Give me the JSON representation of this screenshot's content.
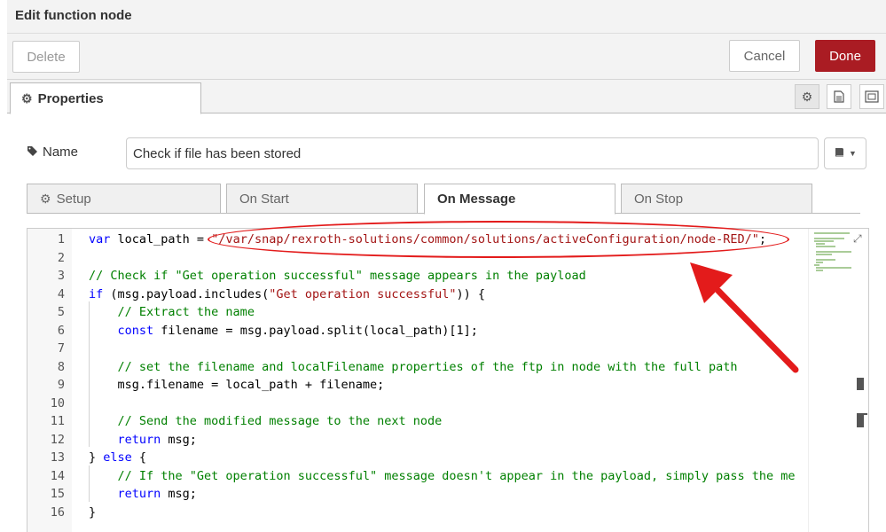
{
  "dialog": {
    "title": "Edit function node"
  },
  "toolbar": {
    "delete_label": "Delete",
    "cancel_label": "Cancel",
    "done_label": "Done",
    "done_color": "#aa1c23"
  },
  "tabs": {
    "properties_label": "Properties",
    "properties_icon": "gear-icon"
  },
  "side_icons": [
    "gear-icon",
    "document-icon",
    "layout-icon"
  ],
  "name_field": {
    "label": "Name",
    "label_icon": "tag-icon",
    "value": "Check if file has been stored",
    "button_icon": "book-icon"
  },
  "subtabs": [
    {
      "label": "Setup",
      "icon": "gear-icon",
      "active": false
    },
    {
      "label": "On Start",
      "active": false
    },
    {
      "label": "On Message",
      "active": true
    },
    {
      "label": "On Stop",
      "active": false
    }
  ],
  "code": {
    "line_numbers": [
      "1",
      "2",
      "3",
      "4",
      "5",
      "6",
      "7",
      "8",
      "9",
      "10",
      "11",
      "12",
      "13",
      "14",
      "15",
      "16"
    ],
    "lines": [
      [
        {
          "t": "var",
          "c": "kw"
        },
        {
          "t": " local_path = "
        },
        {
          "t": "\"/var/snap/rexroth-solutions/common/solutions/activeConfiguration/node-RED/\"",
          "c": "st"
        },
        {
          "t": ";"
        }
      ],
      [],
      [
        {
          "t": "// Check if \"Get operation successful\" message appears in the payload",
          "c": "cm"
        }
      ],
      [
        {
          "t": "if",
          "c": "kw"
        },
        {
          "t": " (msg.payload.includes("
        },
        {
          "t": "\"Get operation successful\"",
          "c": "st"
        },
        {
          "t": ")) {"
        }
      ],
      [
        {
          "t": "    "
        },
        {
          "t": "// Extract the name",
          "c": "cm"
        }
      ],
      [
        {
          "t": "    "
        },
        {
          "t": "const",
          "c": "kw"
        },
        {
          "t": " filename = msg.payload.split(local_path)[1];"
        }
      ],
      [],
      [
        {
          "t": "    "
        },
        {
          "t": "// set the filename and localFilename properties of the ftp in node with the full path",
          "c": "cm"
        }
      ],
      [
        {
          "t": "    msg.filename = local_path + filename;"
        }
      ],
      [],
      [
        {
          "t": "    "
        },
        {
          "t": "// Send the modified message to the next node",
          "c": "cm"
        }
      ],
      [
        {
          "t": "    "
        },
        {
          "t": "return",
          "c": "kw"
        },
        {
          "t": " msg;"
        }
      ],
      [
        {
          "t": "} "
        },
        {
          "t": "else",
          "c": "kw"
        },
        {
          "t": " {"
        }
      ],
      [
        {
          "t": "    "
        },
        {
          "t": "// If the \"Get operation successful\" message doesn't appear in the payload, simply pass the me",
          "c": "cm"
        }
      ],
      [
        {
          "t": "    "
        },
        {
          "t": "return",
          "c": "kw"
        },
        {
          "t": " msg;"
        }
      ],
      [
        {
          "t": "}"
        }
      ]
    ]
  },
  "annotation": {
    "color": "#e31b1b"
  }
}
